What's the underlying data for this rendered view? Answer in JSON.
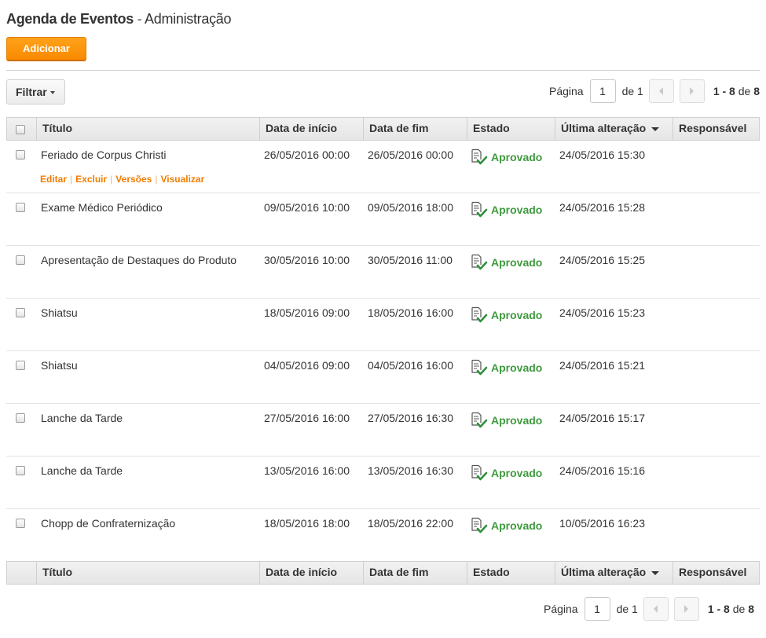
{
  "header": {
    "app_title": "Agenda de Eventos",
    "separator": " - ",
    "section": "Administração"
  },
  "toolbar": {
    "add_label": "Adicionar",
    "filter_label": "Filtrar"
  },
  "pager_top": {
    "page_label": "Página",
    "page_value": "1",
    "of_label": "de 1",
    "range": "1 - 8",
    "range_of": "de",
    "total": "8"
  },
  "pager_bottom": {
    "page_label": "Página",
    "page_value": "1",
    "of_label": "de 1",
    "range": "1 - 8",
    "range_of": "de",
    "total": "8"
  },
  "table": {
    "columns": [
      "Título",
      "Data de início",
      "Data de fim",
      "Estado",
      "Última alteração",
      "Responsável"
    ],
    "row_actions": [
      "Editar",
      "Excluir",
      "Versões",
      "Visualizar"
    ],
    "rows": [
      {
        "title": "Feriado de Corpus Christi",
        "start": "26/05/2016 00:00",
        "end": "26/05/2016 00:00",
        "status": "Aprovado",
        "modified": "24/05/2016 15:30",
        "owner": ""
      },
      {
        "title": "Exame Médico Periódico",
        "start": "09/05/2016 10:00",
        "end": "09/05/2016 18:00",
        "status": "Aprovado",
        "modified": "24/05/2016 15:28",
        "owner": ""
      },
      {
        "title": "Apresentação de Destaques do Produto",
        "start": "30/05/2016 10:00",
        "end": "30/05/2016 11:00",
        "status": "Aprovado",
        "modified": "24/05/2016 15:25",
        "owner": ""
      },
      {
        "title": "Shiatsu",
        "start": "18/05/2016 09:00",
        "end": "18/05/2016 16:00",
        "status": "Aprovado",
        "modified": "24/05/2016 15:23",
        "owner": ""
      },
      {
        "title": "Shiatsu",
        "start": "04/05/2016 09:00",
        "end": "04/05/2016 16:00",
        "status": "Aprovado",
        "modified": "24/05/2016 15:21",
        "owner": ""
      },
      {
        "title": "Lanche da Tarde",
        "start": "27/05/2016 16:00",
        "end": "27/05/2016 16:30",
        "status": "Aprovado",
        "modified": "24/05/2016 15:17",
        "owner": ""
      },
      {
        "title": "Lanche da Tarde",
        "start": "13/05/2016 16:00",
        "end": "13/05/2016 16:30",
        "status": "Aprovado",
        "modified": "24/05/2016 15:16",
        "owner": ""
      },
      {
        "title": "Chopp de Confraternização",
        "start": "18/05/2016 18:00",
        "end": "18/05/2016 22:00",
        "status": "Aprovado",
        "modified": "10/05/2016 16:23",
        "owner": ""
      }
    ]
  },
  "colors": {
    "accent": "#f98a00",
    "status_approved": "#3e9a3e",
    "link": "#f07c00"
  },
  "icons": {
    "status": "document-check-icon",
    "sort": "sort-desc-icon",
    "prev": "chevron-left-icon",
    "next": "chevron-right-icon",
    "filter_caret": "caret-down-icon"
  }
}
